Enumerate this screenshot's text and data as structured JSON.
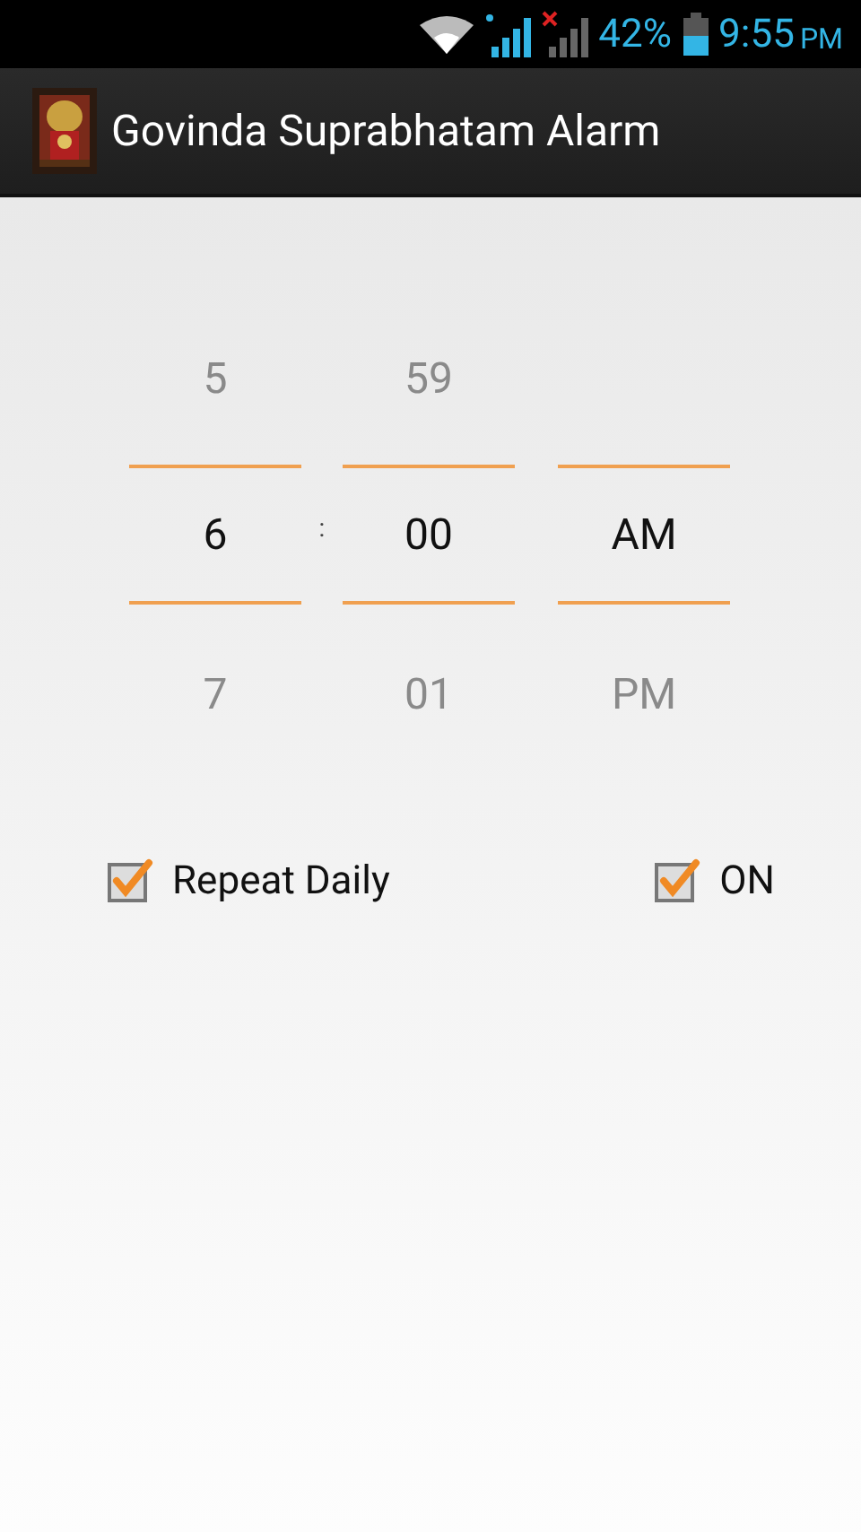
{
  "status_bar": {
    "battery": "42%",
    "time": "9:55",
    "time_suffix": "PM"
  },
  "app_bar": {
    "title": "Govinda Suprabhatam Alarm"
  },
  "picker": {
    "separator": ":",
    "columns": [
      {
        "previous": "5",
        "current": "6",
        "next": "7"
      },
      {
        "previous": "59",
        "current": "00",
        "next": "01"
      },
      {
        "current": "AM",
        "next": "PM"
      }
    ]
  },
  "options": [
    {
      "label": "Repeat Daily",
      "checked": true
    },
    {
      "label": "ON",
      "checked": true
    }
  ]
}
